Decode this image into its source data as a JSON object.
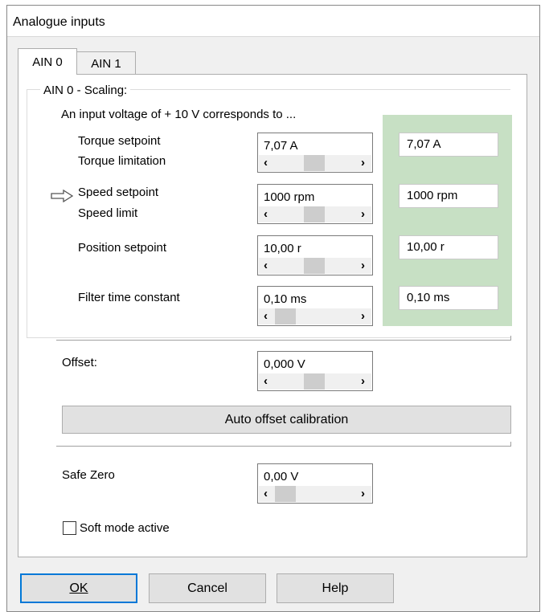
{
  "window": {
    "title": "Analogue inputs"
  },
  "tabs": [
    {
      "label": "AIN 0"
    },
    {
      "label": "AIN 1"
    }
  ],
  "scaling": {
    "group_title": "AIN 0 - Scaling:",
    "intro": "An input voltage of + 10 V corresponds to ...",
    "rows": [
      {
        "label1": "Torque setpoint",
        "label2": "Torque limitation",
        "value": "7,07 A",
        "readout": "7,07 A",
        "slider_level": 0.5
      },
      {
        "label1": "Speed setpoint",
        "label2": "Speed limit",
        "value": "1000 rpm",
        "readout": "1000 rpm",
        "slider_level": 0.5
      },
      {
        "label1": "Position setpoint",
        "label2": "",
        "value": "10,00 r",
        "readout": "10,00 r",
        "slider_level": 0.5
      },
      {
        "label1": "Filter time constant",
        "label2": "",
        "value": "0,10 ms",
        "readout": "0,10 ms",
        "slider_level": 0.0
      }
    ]
  },
  "offset": {
    "label": "Offset:",
    "value": "0,000 V",
    "slider_level": 0.5
  },
  "calibration_button": {
    "label": "Auto offset calibration"
  },
  "safe_zero": {
    "label": "Safe Zero",
    "value": "0,00 V",
    "slider_level": 0.0
  },
  "soft_mode": {
    "label": "Soft mode active",
    "checked": false
  },
  "buttons": {
    "ok": "OK",
    "cancel": "Cancel",
    "help": "Help"
  },
  "colors": {
    "readout_panel": "#c7e0c4",
    "default_button_border": "#0078d7"
  }
}
